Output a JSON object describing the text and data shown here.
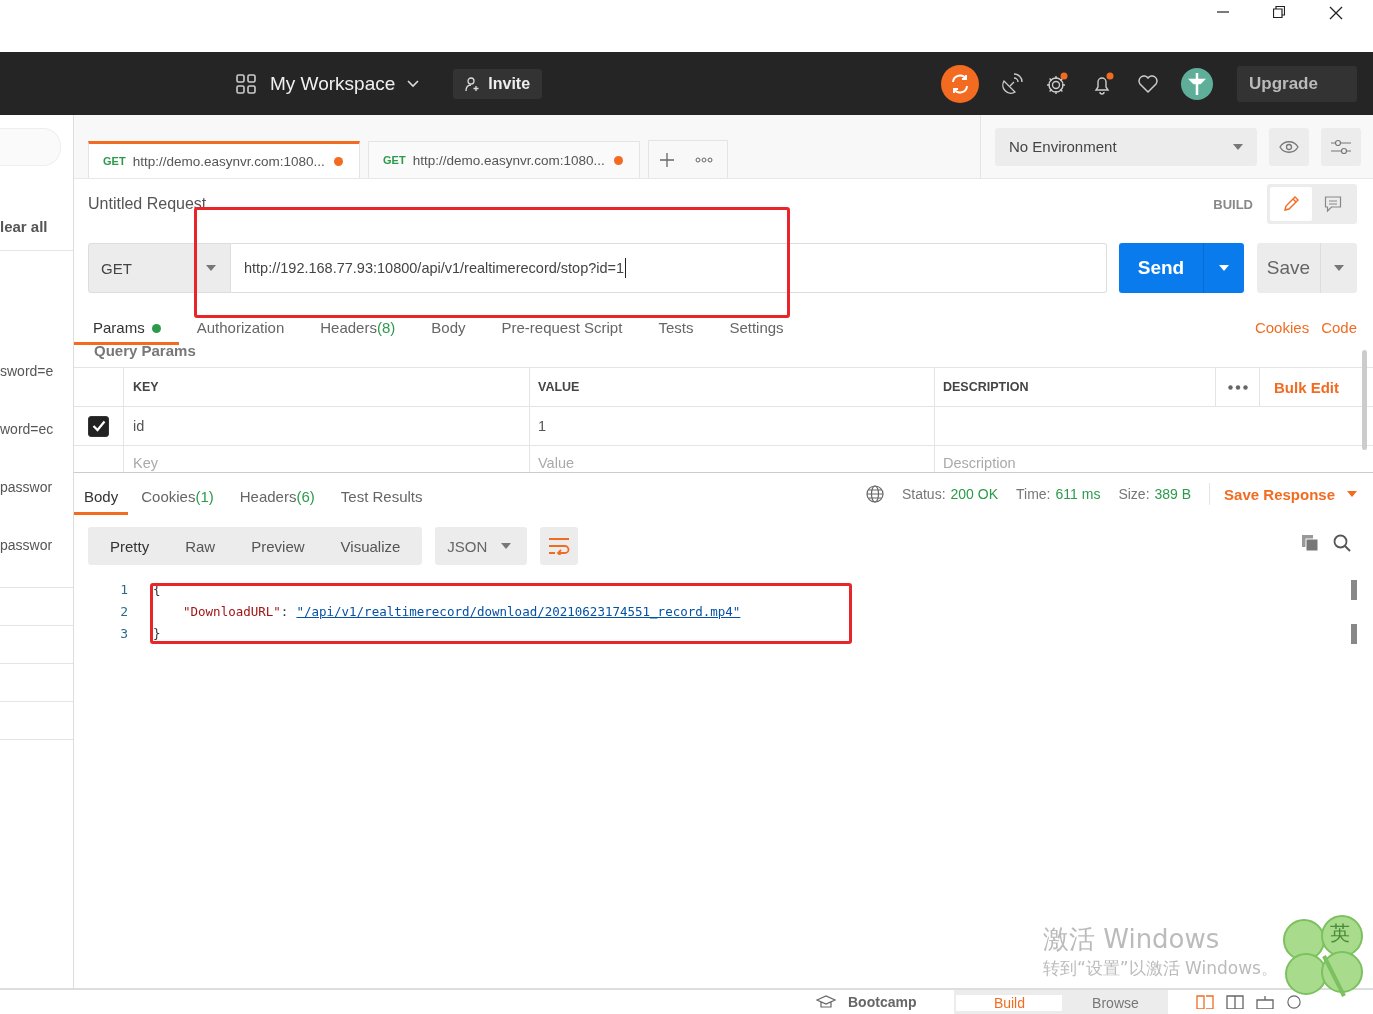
{
  "header": {
    "workspace": "My Workspace",
    "invite": "Invite",
    "upgrade": "Upgrade"
  },
  "sidebar": {
    "clear": "lear all",
    "items": [
      "sword=e",
      "word=ec",
      "passwor",
      "passwor"
    ]
  },
  "tabs": [
    {
      "method": "GET",
      "url": "http://demo.easynvr.com:1080...",
      "selected": true,
      "unsaved": true
    },
    {
      "method": "GET",
      "url": "http://demo.easynvr.com:1080...",
      "selected": false,
      "unsaved": true
    }
  ],
  "environment": "No Environment",
  "view_toggle": [
    {
      "kind": "pencil",
      "selected": true
    },
    {
      "kind": "comment",
      "selected": false
    }
  ],
  "request": {
    "title": "Untitled Request",
    "mode": "BUILD",
    "method": "GET",
    "url": "http://192.168.77.93:10800/api/v1/realtimerecord/stop?id=1",
    "send": "Send",
    "save": "Save"
  },
  "request_tabs": [
    {
      "label": "Params",
      "selected": true,
      "dot": true
    },
    {
      "label": "Authorization",
      "selected": false
    },
    {
      "label": "Headers",
      "count": "(8)",
      "selected": false
    },
    {
      "label": "Body",
      "selected": false
    },
    {
      "label": "Pre-request Script",
      "selected": false
    },
    {
      "label": "Tests",
      "selected": false
    },
    {
      "label": "Settings",
      "selected": false
    }
  ],
  "links": [
    "Cookies",
    "Code"
  ],
  "query_params": {
    "title": "Query Params",
    "columns": [
      "KEY",
      "VALUE",
      "DESCRIPTION"
    ],
    "bulk_edit": "Bulk Edit",
    "rows": [
      {
        "checked": true,
        "key": "id",
        "value": "1"
      }
    ],
    "new_row": {
      "key": {
        "placeholder": "Key"
      },
      "value": {
        "placeholder": "Value"
      },
      "description": {
        "placeholder": "Description"
      }
    }
  },
  "response_tabs": [
    {
      "label": "Body",
      "selected": true
    },
    {
      "label": "Cookies",
      "count": "(1)",
      "selected": false
    },
    {
      "label": "Headers",
      "count": "(6)",
      "selected": false
    },
    {
      "label": "Test Results",
      "selected": false
    }
  ],
  "status": [
    {
      "label": "Status:",
      "value": "200 OK"
    },
    {
      "label": "Time:",
      "value": "611 ms"
    },
    {
      "label": "Size:",
      "value": "389 B"
    }
  ],
  "save_response": "Save Response",
  "view_modes": [
    {
      "label": "Pretty",
      "selected": true
    },
    {
      "label": "Raw",
      "selected": false
    },
    {
      "label": "Preview",
      "selected": false
    },
    {
      "label": "Visualize",
      "selected": false
    }
  ],
  "format": "JSON",
  "code_lines": [
    {
      "number": "1",
      "kind": "brace",
      "text": "{"
    },
    {
      "number": "2",
      "kind": "pair",
      "key": "\"DownloadURL\"",
      "colon": ":",
      "value": "\"/api/v1/realtimerecord/download/20210623174551_record.mp4\""
    },
    {
      "number": "3",
      "kind": "brace",
      "text": "}"
    }
  ],
  "activation": {
    "title": "激活 Windows",
    "subtitle": "转到“设置”以激活 Windows。"
  },
  "ime": "英",
  "footer": {
    "bootcamp": "Bootcamp",
    "modes": [
      {
        "label": "Build",
        "selected": true
      },
      {
        "label": "Browse",
        "selected": false
      }
    ]
  }
}
